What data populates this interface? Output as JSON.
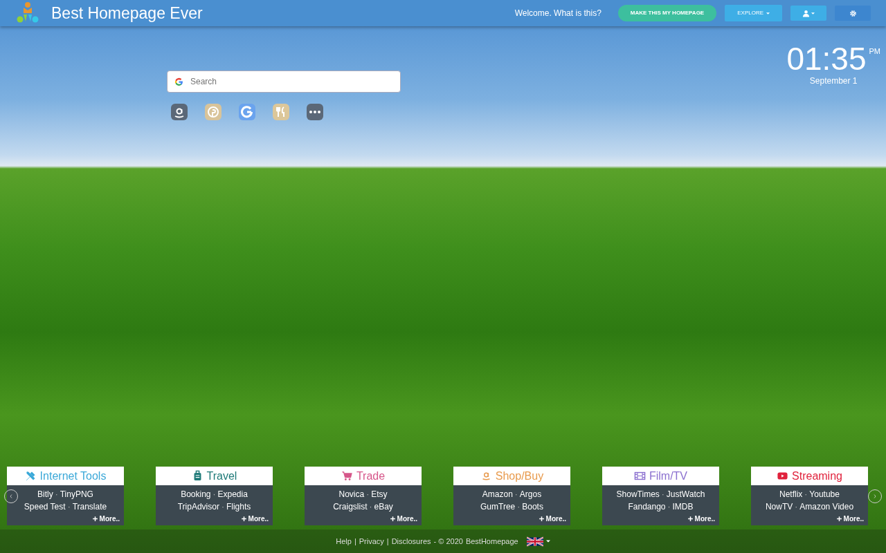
{
  "header": {
    "title": "Best Homepage Ever",
    "welcome": "Welcome. What is this?",
    "make_homepage": "MAKE THIS MY HOMEPAGE",
    "explore": "EXPLORE"
  },
  "search": {
    "placeholder": "Search"
  },
  "shortcuts": [
    {
      "kind": "amazon"
    },
    {
      "kind": "pinterest"
    },
    {
      "kind": "google"
    },
    {
      "kind": "food"
    },
    {
      "kind": "more"
    }
  ],
  "clock": {
    "time": "01:35",
    "ampm": "PM",
    "date": "September 1"
  },
  "link_separator": "·",
  "categories": [
    {
      "title": "Internet Tools",
      "kind": "tools",
      "color": "#3aa8d8",
      "lines": [
        [
          "Bitly",
          "TinyPNG"
        ],
        [
          "Speed Test",
          "Translate"
        ]
      ],
      "more": "More.."
    },
    {
      "title": "Travel",
      "kind": "suitcase",
      "color": "#1f7a78",
      "lines": [
        [
          "Booking",
          "Expedia"
        ],
        [
          "TripAdvisor",
          "Flights"
        ]
      ],
      "more": "More.."
    },
    {
      "title": "Trade",
      "kind": "cart",
      "color": "#d6578a",
      "lines": [
        [
          "Novica",
          "Etsy"
        ],
        [
          "Craigslist",
          "eBay"
        ]
      ],
      "more": "More.."
    },
    {
      "title": "Shop/Buy",
      "kind": "amazon",
      "color": "#e89a4c",
      "lines": [
        [
          "Amazon",
          "Argos"
        ],
        [
          "GumTree",
          "Boots"
        ]
      ],
      "more": "More.."
    },
    {
      "title": "Film/TV",
      "kind": "film",
      "color": "#8a6fcf",
      "lines": [
        [
          "ShowTimes",
          "JustWatch"
        ],
        [
          "Fandango",
          "IMDB"
        ]
      ],
      "more": "More.."
    },
    {
      "title": "Streaming",
      "kind": "play",
      "color": "#e0223c",
      "lines": [
        [
          "Netflix",
          "Youtube"
        ],
        [
          "NowTV",
          "Amazon Video"
        ]
      ],
      "more": "More.."
    }
  ],
  "footer": {
    "links": [
      "Help",
      "Privacy",
      "Disclosures"
    ],
    "separator": "|",
    "copyright": "- © 2020",
    "brand": "BestHomepage"
  }
}
